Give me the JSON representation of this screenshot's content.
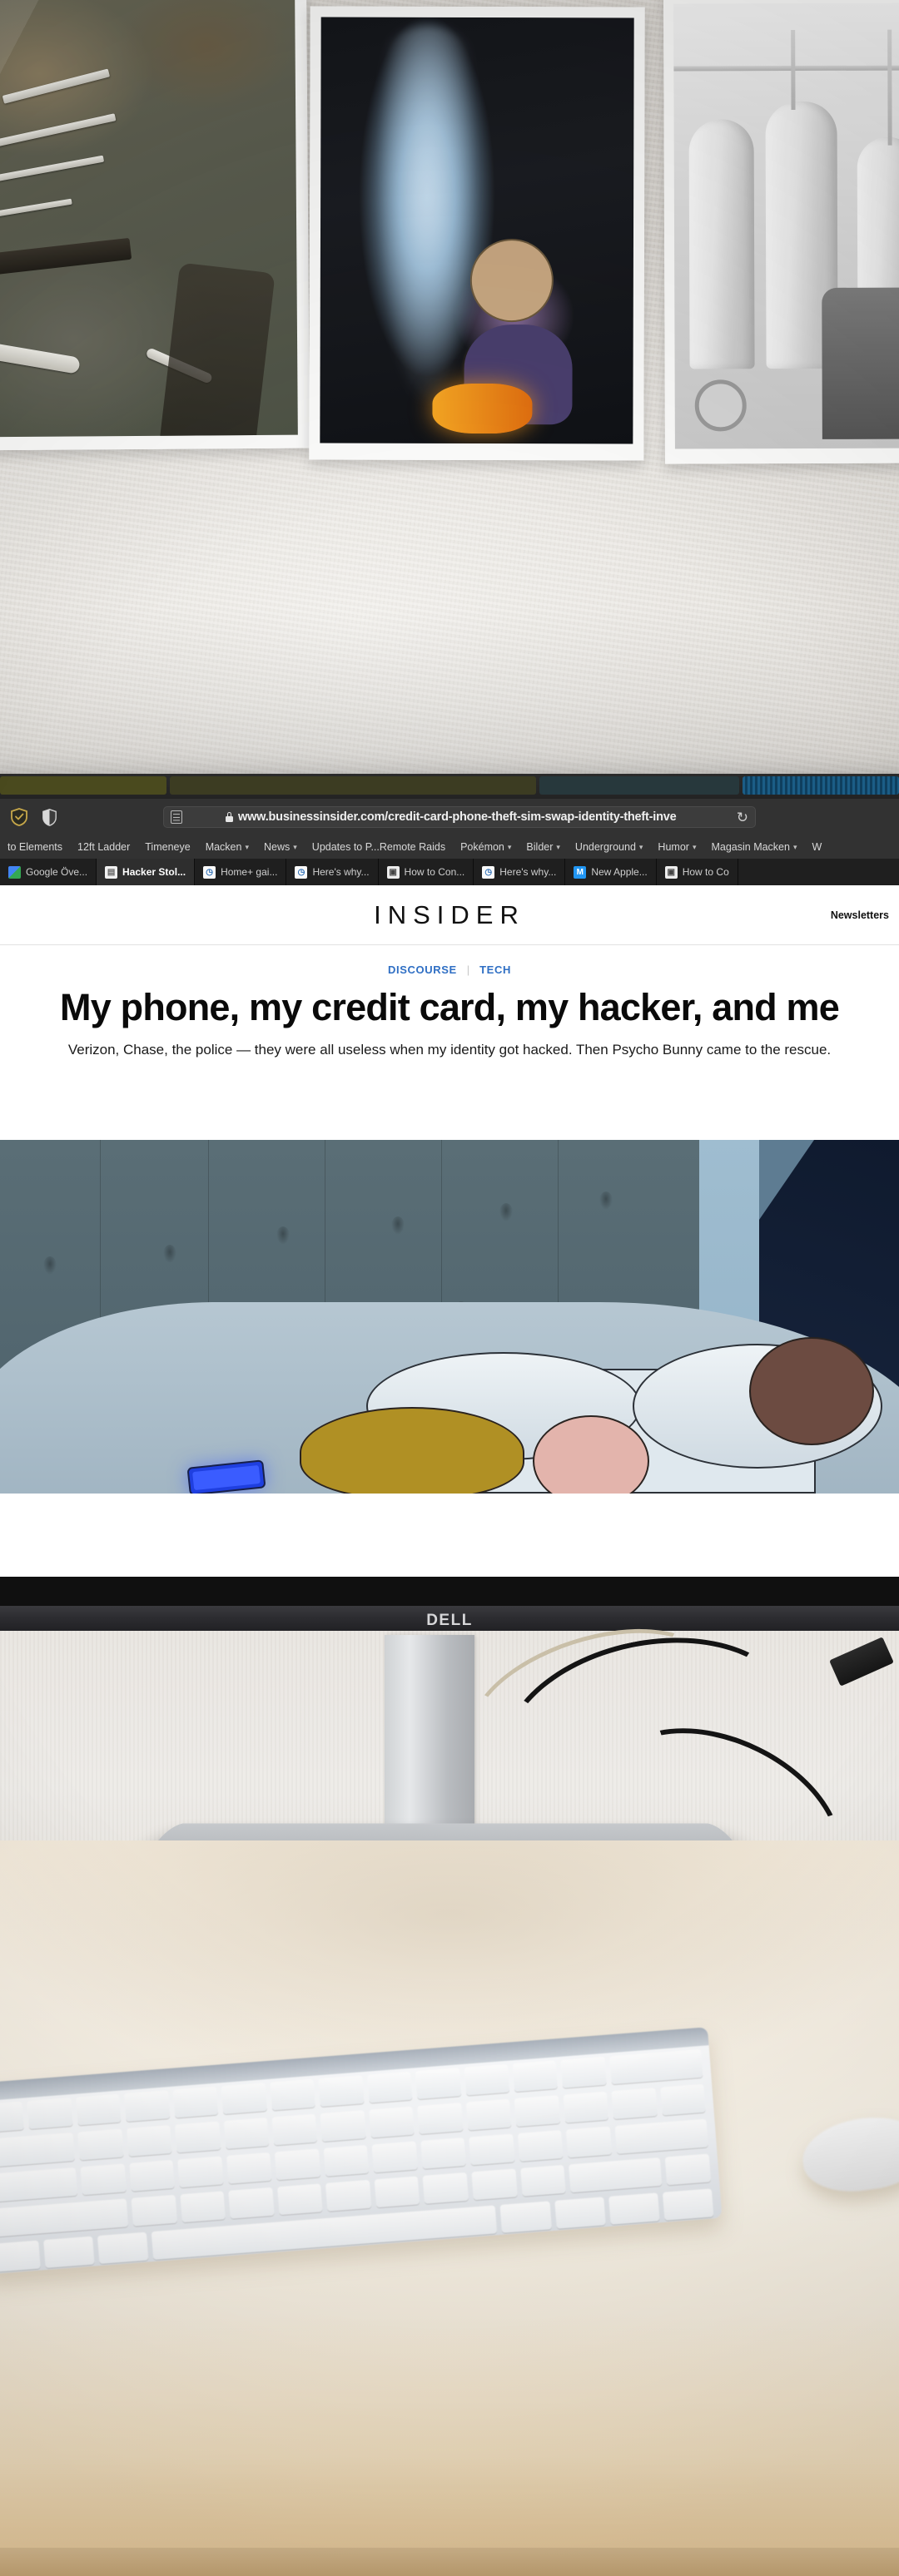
{
  "browser": {
    "toolbar_icons": [
      "shield-gold-icon",
      "shield-privacy-icon"
    ],
    "reader_icon": "reader-view-icon",
    "lock_icon": "lock-icon",
    "url": "www.businessinsider.com/credit-card-phone-theft-sim-swap-identity-theft-inve",
    "reload_icon": "↻",
    "bookmarks": [
      {
        "label": "to Elements",
        "has_menu": false
      },
      {
        "label": "12ft Ladder",
        "has_menu": false
      },
      {
        "label": "Timeneye",
        "has_menu": false
      },
      {
        "label": "Macken",
        "has_menu": true
      },
      {
        "label": "News",
        "has_menu": true
      },
      {
        "label": "Updates to P...Remote Raids",
        "has_menu": false
      },
      {
        "label": "Pokémon",
        "has_menu": true
      },
      {
        "label": "Bilder",
        "has_menu": true
      },
      {
        "label": "Underground",
        "has_menu": true
      },
      {
        "label": "Humor",
        "has_menu": true
      },
      {
        "label": "Magasin Macken",
        "has_menu": true
      },
      {
        "label": "W",
        "has_menu": false
      }
    ],
    "tabs": [
      {
        "label": "Google Öve...",
        "favicon": "google-docs-icon",
        "active": false
      },
      {
        "label": "Hacker Stol...",
        "favicon": "document-icon",
        "active": true
      },
      {
        "label": "Home+ gai...",
        "favicon": "clock-icon",
        "active": false
      },
      {
        "label": "Here's why...",
        "favicon": "clock-icon",
        "active": false
      },
      {
        "label": "How to Con...",
        "favicon": "mask-icon",
        "active": false
      },
      {
        "label": "Here's why...",
        "favicon": "clock-icon",
        "active": false
      },
      {
        "label": "New Apple...",
        "favicon": "macrumors-icon",
        "active": false
      },
      {
        "label": "How to Co",
        "favicon": "mask-icon",
        "active": false
      }
    ]
  },
  "site": {
    "brand": "INSIDER",
    "newsletters_label": "Newsletters",
    "kicker": {
      "category": "DISCOURSE",
      "separator": "|",
      "subcategory": "TECH",
      "color": "#2f6fc4"
    },
    "headline": "My phone, my credit card, my hacker, and me",
    "dek": "Verizon, Chase, the police — they were all useless when my identity got hacked. Then Psycho Bunny came to the rescue.",
    "hero_alt": "Illustration of a couple asleep in bed with a glowing blue phone"
  },
  "hardware": {
    "monitor_brand": "DELL",
    "keyboard": "white-keyboard",
    "mouse": "white-mouse"
  },
  "wall_prints": [
    {
      "name": "workbench-tools-print"
    },
    {
      "name": "glassblower-print"
    },
    {
      "name": "brewery-tanks-print"
    }
  ]
}
